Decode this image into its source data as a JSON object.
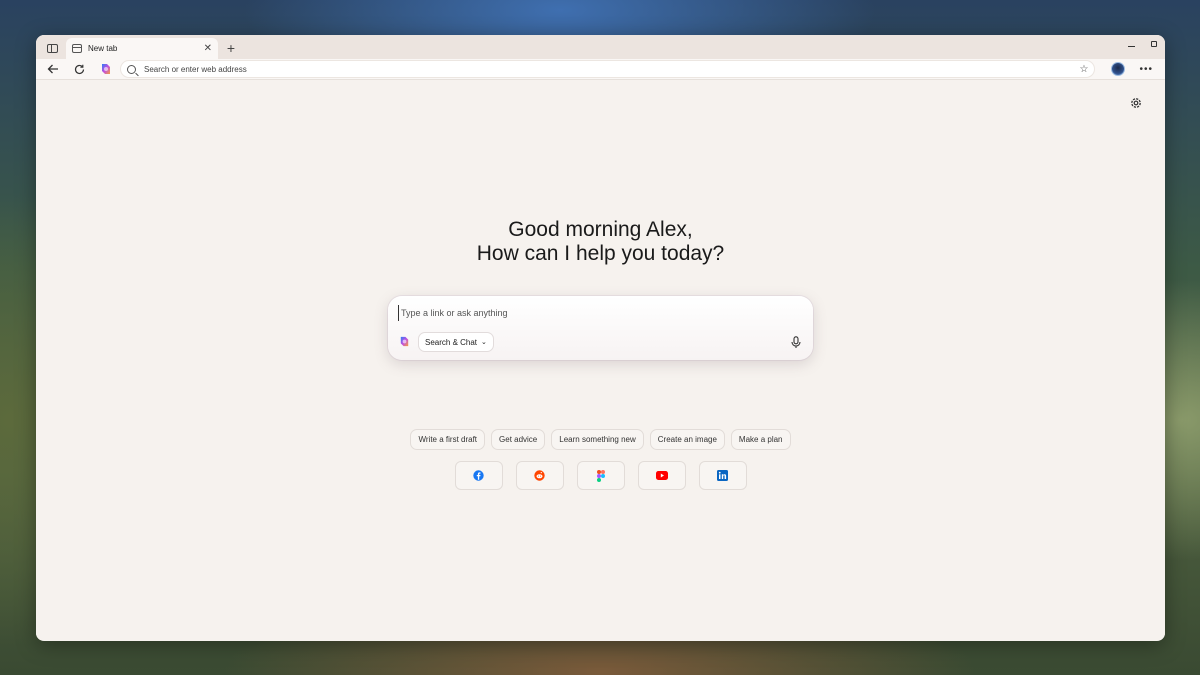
{
  "tabs": [
    {
      "title": "New tab"
    }
  ],
  "address_bar": {
    "placeholder": "Search or enter web address"
  },
  "greeting": {
    "line1": "Good morning Alex,",
    "line2": "How can I help you today?"
  },
  "search": {
    "placeholder": "Type a link or ask anything",
    "mode_label": "Search & Chat"
  },
  "suggestions": [
    "Write a first draft",
    "Get advice",
    "Learn something new",
    "Create an image",
    "Make a plan"
  ],
  "shortcuts": [
    {
      "icon": "facebook-icon",
      "color": "#1877f2"
    },
    {
      "icon": "reddit-icon",
      "color": "#ff4500"
    },
    {
      "icon": "figma-icon",
      "color": "#a259ff"
    },
    {
      "icon": "youtube-icon",
      "color": "#ff0000"
    },
    {
      "icon": "linkedin-icon",
      "color": "#0a66c2"
    }
  ]
}
